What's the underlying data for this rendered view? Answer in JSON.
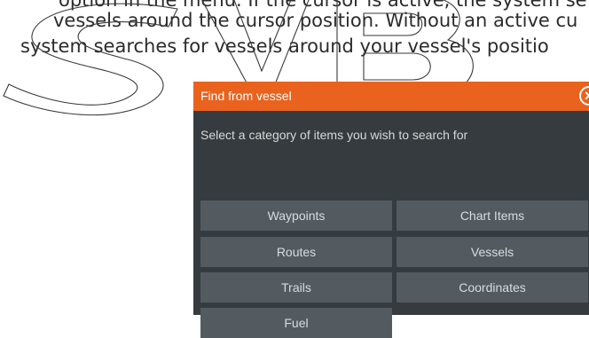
{
  "document": {
    "line1": "option in the menu. If the cursor is active, the system se",
    "line2": "vessels around the cursor position. Without an active cu",
    "line3": "system searches for vessels around your vessel's positio"
  },
  "dialog": {
    "title": "Find from vessel",
    "prompt": "Select a category of items you wish to search for",
    "categories": [
      "Waypoints",
      "Chart Items",
      "Routes",
      "Vessels",
      "Trails",
      "Coordinates",
      "Fuel"
    ]
  },
  "colors": {
    "header": "#e9631e",
    "dialog_bg": "#353b3f",
    "button_bg": "#535b61"
  },
  "icons": {
    "close": "close-icon"
  }
}
